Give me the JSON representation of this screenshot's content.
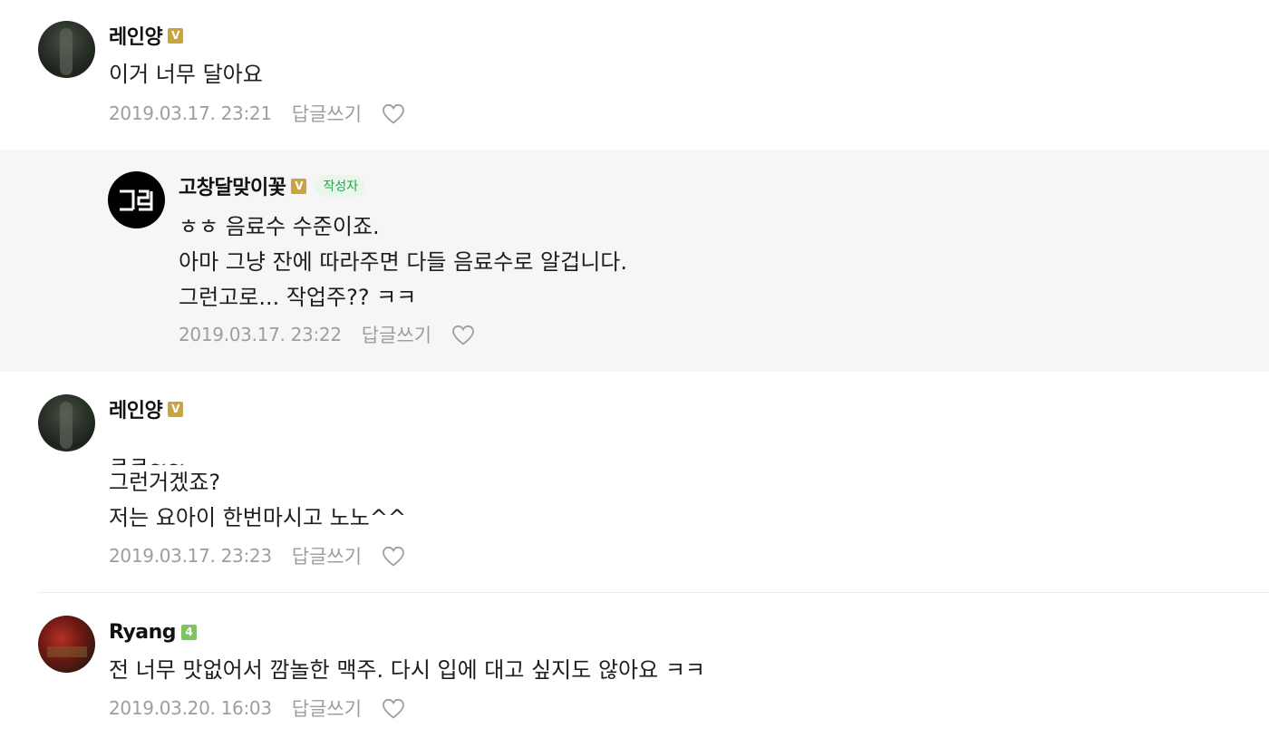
{
  "comments": [
    {
      "author": "레인양",
      "badge": "V",
      "lines": [
        "이거 너무 달아요"
      ],
      "date": "2019.03.17. 23:21",
      "reply_label": "답글쓰기"
    },
    {
      "author": "고창달맞이꽃",
      "badge": "V",
      "writer_tag": "작성자",
      "lines": [
        "ㅎㅎ 음료수 수준이죠.",
        "아마 그냥 잔에 따라주면 다들 음료수로 알겁니다.",
        "그런고로... 작업주?? ㅋㅋ"
      ],
      "date": "2019.03.17. 23:22",
      "reply_label": "답글쓰기"
    },
    {
      "author": "레인양",
      "badge": "V",
      "lines": [
        "ㅋㅋ~~",
        "그런거겠죠?",
        "저는 요아이 한번마시고 노노^^"
      ],
      "date": "2019.03.17. 23:23",
      "reply_label": "답글쓰기"
    },
    {
      "author": "Ryang",
      "badge": "4",
      "lines": [
        "전 너무 맛없어서 깜놀한 맥주. 다시 입에 대고 싶지도 않아요 ㅋㅋ"
      ],
      "date": "2019.03.20. 16:03",
      "reply_label": "답글쓰기"
    }
  ],
  "colors": {
    "badge_v": "#c9a53e",
    "badge_level": "#7ec560",
    "writer_tag_text": "#2aa34a",
    "writer_tag_bg": "#e9f6ec",
    "reply_bg": "#f6f6f6",
    "meta_text": "#9e9e9e"
  },
  "icons": {
    "like": "heart-outline-icon",
    "owner_avatar": "owner-logo-icon"
  }
}
